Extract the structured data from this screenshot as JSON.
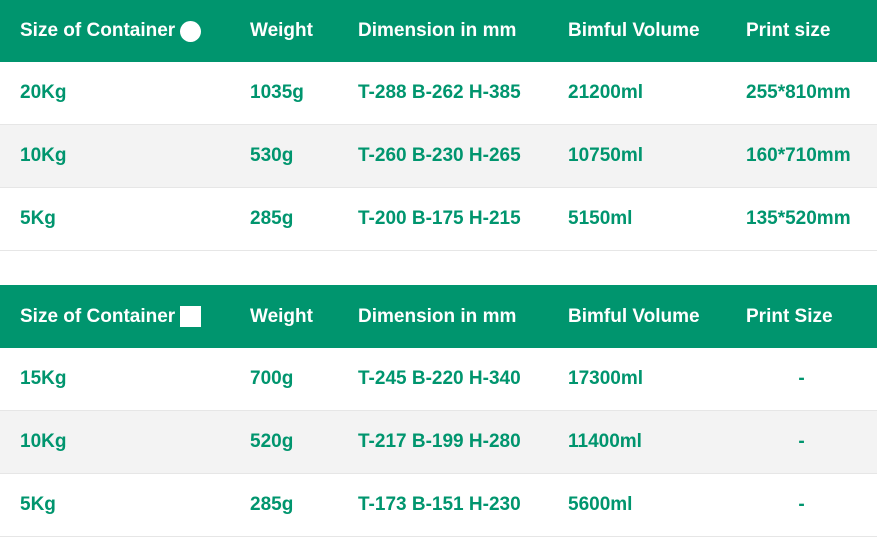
{
  "table_round": {
    "headers": [
      "Size of Container",
      "Weight",
      "Dimension in mm",
      "Bimful Volume",
      "Print size"
    ],
    "shape_icon": "circle-icon",
    "rows": [
      [
        "20Kg",
        "1035g",
        "T-288 B-262 H-385",
        "21200ml",
        "255*810mm"
      ],
      [
        "10Kg",
        "530g",
        "T-260 B-230 H-265",
        "10750ml",
        "160*710mm"
      ],
      [
        "5Kg",
        "285g",
        "T-200 B-175 H-215",
        "5150ml",
        "135*520mm"
      ]
    ]
  },
  "table_square": {
    "headers": [
      "Size of Container",
      "Weight",
      "Dimension in mm",
      "Bimful Volume",
      "Print Size"
    ],
    "shape_icon": "square-icon",
    "rows": [
      [
        "15Kg",
        "700g",
        "T-245 B-220 H-340",
        "17300ml",
        "-"
      ],
      [
        "10Kg",
        "520g",
        "T-217 B-199 H-280",
        "11400ml",
        "-"
      ],
      [
        "5Kg",
        "285g",
        "T-173 B-151 H-230",
        "5600ml",
        "-"
      ]
    ]
  },
  "colors": {
    "accent": "#00956e",
    "alt_row": "#f3f3f3",
    "header_text": "#ffffff"
  }
}
